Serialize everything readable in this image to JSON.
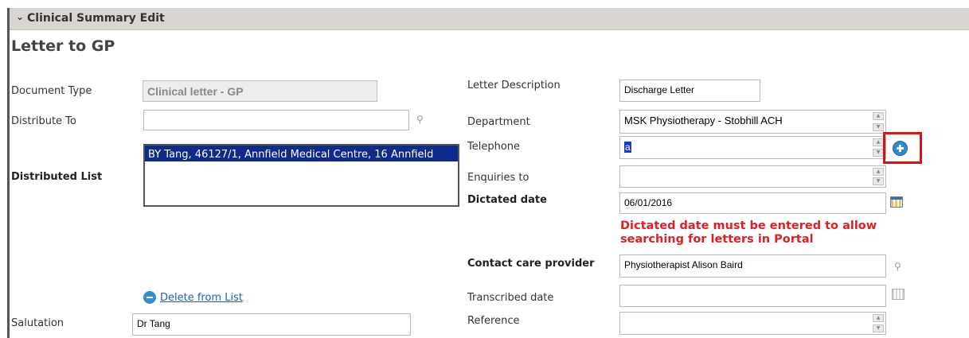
{
  "section": {
    "title": "Clinical Summary Edit"
  },
  "form": {
    "title": "Letter to GP"
  },
  "document_type": {
    "label": "Document Type",
    "value": "Clinical letter - GP"
  },
  "distribute_to": {
    "label": "Distribute To",
    "value": ""
  },
  "distributed_list": {
    "label": "Distributed List",
    "items": [
      "BY Tang, 46127/1, Annfield Medical Centre, 16 Annfield"
    ]
  },
  "delete_from_list": {
    "label": "Delete from List"
  },
  "salutation": {
    "label": "Salutation",
    "value": "Dr Tang"
  },
  "letter_description": {
    "label": "Letter Description",
    "value": "Discharge Letter"
  },
  "department": {
    "label": "Department",
    "value": "MSK Physiotherapy - Stobhill ACH"
  },
  "telephone": {
    "label": "Telephone",
    "value": "a"
  },
  "enquiries_to": {
    "label": "Enquiries to",
    "value": ""
  },
  "dictated_date": {
    "label": "Dictated date",
    "value": "06/01/2016",
    "warning_line1": "Dictated date must be entered to allow",
    "warning_line2": "searching for letters in Portal",
    "warning_color": "#e02020"
  },
  "contact_care_provider": {
    "label": "Contact care provider",
    "value": "Physiotherapist Alison Baird"
  },
  "transcribed_date": {
    "label": "Transcribed date",
    "value": ""
  },
  "reference": {
    "label": "Reference",
    "value": ""
  },
  "icons": {
    "collapse": "chevron-down-icon",
    "search": "magnifier-icon",
    "add": "plus-circle-icon",
    "remove": "minus-circle-icon",
    "calendar": "calendar-icon"
  },
  "colors": {
    "highlight": "#e01010",
    "selection": "#0e2a8c",
    "link": "#1f5fae"
  }
}
